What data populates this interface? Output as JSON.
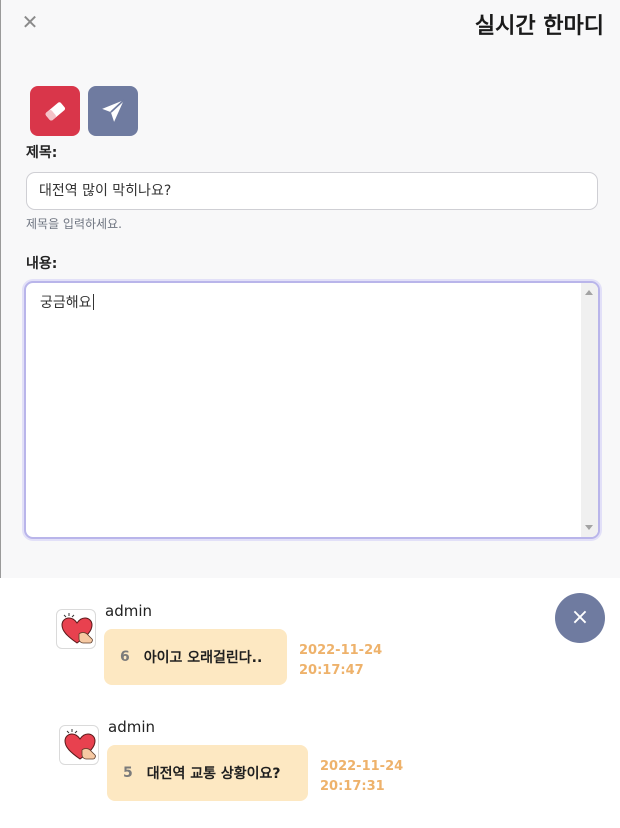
{
  "header": {
    "close_icon": "close-icon",
    "title": "실시간 한마디"
  },
  "toolbar": {
    "erase_icon": "eraser-icon",
    "send_icon": "paper-plane-icon",
    "erase_color": "#d9364a",
    "send_color": "#6f7ba0"
  },
  "form": {
    "subject_label": "제목:",
    "subject_value": "대전역 많이 막히나요?",
    "subject_help": "제목을 입력하세요.",
    "content_label": "내용:",
    "content_value": "궁금해요"
  },
  "messages": [
    {
      "author": "admin",
      "number": "6",
      "text": "아이고 오래걸린다..",
      "date": "2022-11-24",
      "time": "20:17:47",
      "avatar_icon": "heart-hand-icon"
    },
    {
      "author": "admin",
      "number": "5",
      "text": "대전역 교통 상황이요?",
      "date": "2022-11-24",
      "time": "20:17:31",
      "avatar_icon": "heart-hand-icon"
    }
  ],
  "fab": {
    "icon": "close-icon",
    "label": "×"
  },
  "colors": {
    "accent": "#6f7ba0",
    "bubble": "#fde8c2",
    "timestamp": "#eeb26b"
  }
}
